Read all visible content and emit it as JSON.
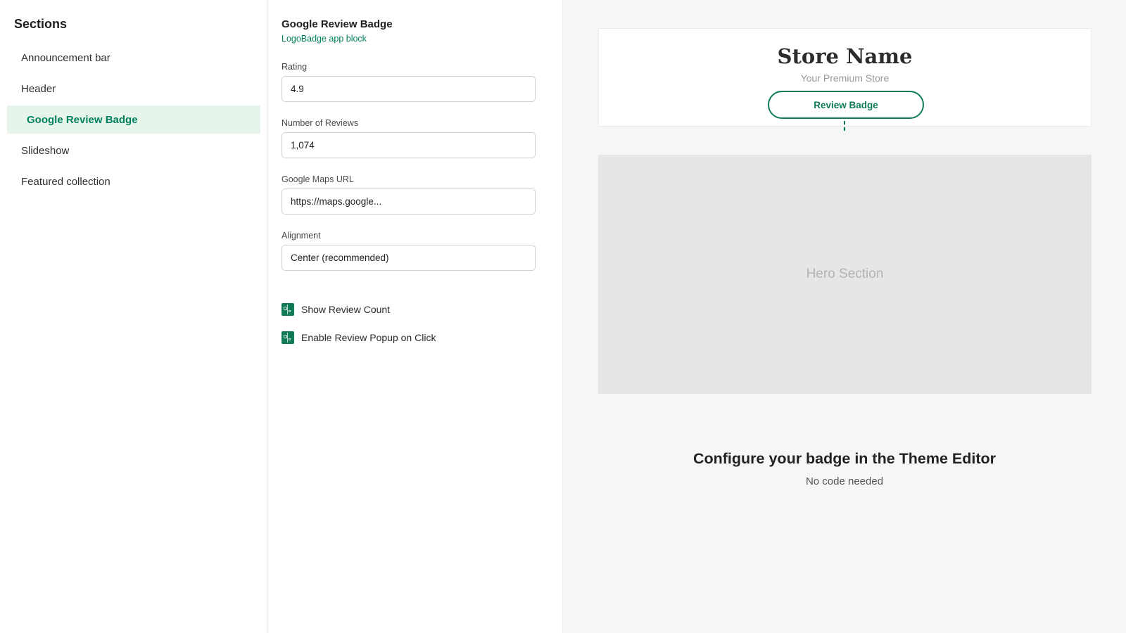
{
  "sidebar": {
    "title": "Sections",
    "items": [
      {
        "label": "Announcement bar"
      },
      {
        "label": "Header"
      },
      {
        "label": "Google Review Badge"
      },
      {
        "label": "Slideshow"
      },
      {
        "label": "Featured collection"
      }
    ]
  },
  "settings": {
    "title": "Google Review Badge",
    "subtitle": "LogoBadge app block",
    "fields": {
      "rating": {
        "label": "Rating",
        "value": "4.9"
      },
      "reviews": {
        "label": "Number of Reviews",
        "value": "1,074"
      },
      "maps_url": {
        "label": "Google Maps URL",
        "value": "https://maps.google..."
      },
      "alignment": {
        "label": "Alignment",
        "value": "Center (recommended)"
      }
    },
    "toggles": {
      "show_count": {
        "label": "Show Review Count"
      },
      "popup": {
        "label": "Enable Review Popup on Click"
      }
    }
  },
  "preview": {
    "store_name": "Store Name",
    "tagline": "Your Premium Store",
    "badge_label": "Review Badge",
    "hero_label": "Hero Section",
    "cta_title": "Configure your badge in the Theme Editor",
    "cta_subtitle": "No code needed"
  },
  "colors": {
    "accent": "#0f7a5a",
    "active_bg": "#e6f4ea",
    "preview_bg": "#f6f6f6",
    "hero_bg": "#e6e6e6"
  },
  "icons": {
    "toggle": "checkbox-toggle-icon"
  }
}
